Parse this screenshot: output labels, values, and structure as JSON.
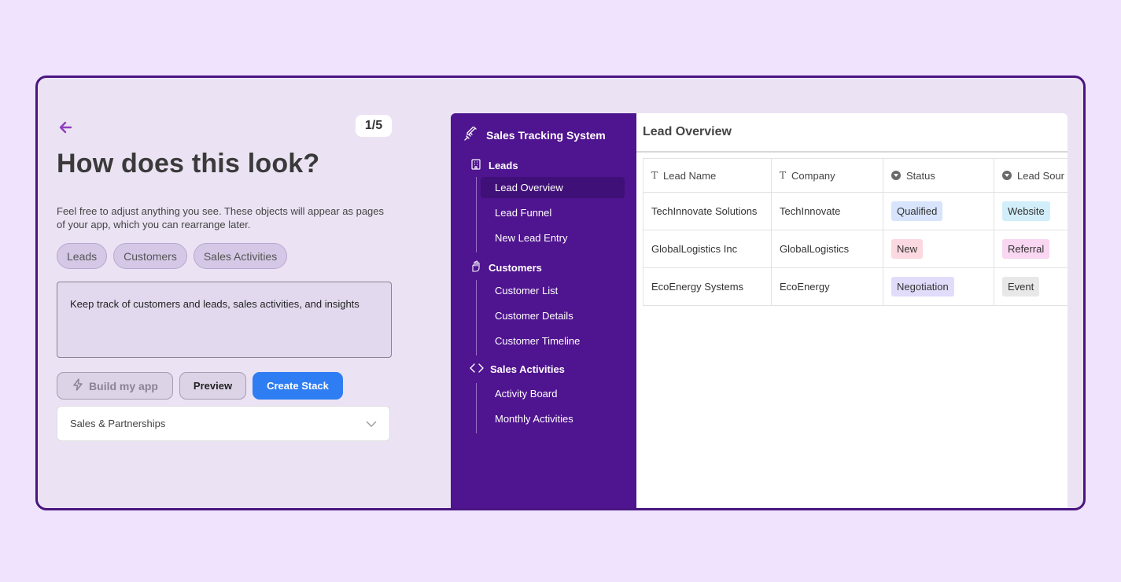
{
  "left": {
    "step": "1/5",
    "headline": "How does this look?",
    "description": "Feel free to adjust anything you see. These objects will appear as pages of your app, which you can rearrange later.",
    "chips": [
      "Leads",
      "Customers",
      "Sales Activities"
    ],
    "prompt_text": "Keep track of customers and leads, sales activities, and insights",
    "buttons": {
      "build": "Build my app",
      "preview": "Preview",
      "create": "Create Stack"
    },
    "dropdown_value": "Sales & Partnerships",
    "accent_color": "#8e3fbf"
  },
  "app": {
    "title": "Sales Tracking System",
    "sections": [
      {
        "label": "Leads",
        "icon": "building-icon",
        "items": [
          "Lead Overview",
          "Lead Funnel",
          "New Lead Entry"
        ],
        "active_index": 0
      },
      {
        "label": "Customers",
        "icon": "hand-icon",
        "items": [
          "Customer List",
          "Customer Details",
          "Customer Timeline"
        ]
      },
      {
        "label": "Sales Activities",
        "icon": "code-icon",
        "items": [
          "Activity Board",
          "Monthly Activities"
        ]
      }
    ],
    "page_title": "Lead Overview",
    "table": {
      "headers": [
        "Lead Name",
        "Company",
        "Status",
        "Lead Sour"
      ],
      "rows": [
        [
          "TechInnovate Solutions",
          "TechInnovate",
          "Qualified",
          "Website"
        ],
        [
          "GlobalLogistics Inc",
          "GlobalLogistics",
          "New",
          "Referral"
        ],
        [
          "EcoEnergy Systems",
          "EcoEnergy",
          "Negotiation",
          "Event"
        ]
      ]
    },
    "colors": {
      "sidebar": "#4f148f",
      "status_qualified": "#d7e4fb",
      "status_new": "#fcd9e0",
      "status_negotiation": "#e2dcfb",
      "source_website": "#d2eefa",
      "source_referral": "#f9d6f1",
      "source_event": "#e8e8e8"
    }
  }
}
